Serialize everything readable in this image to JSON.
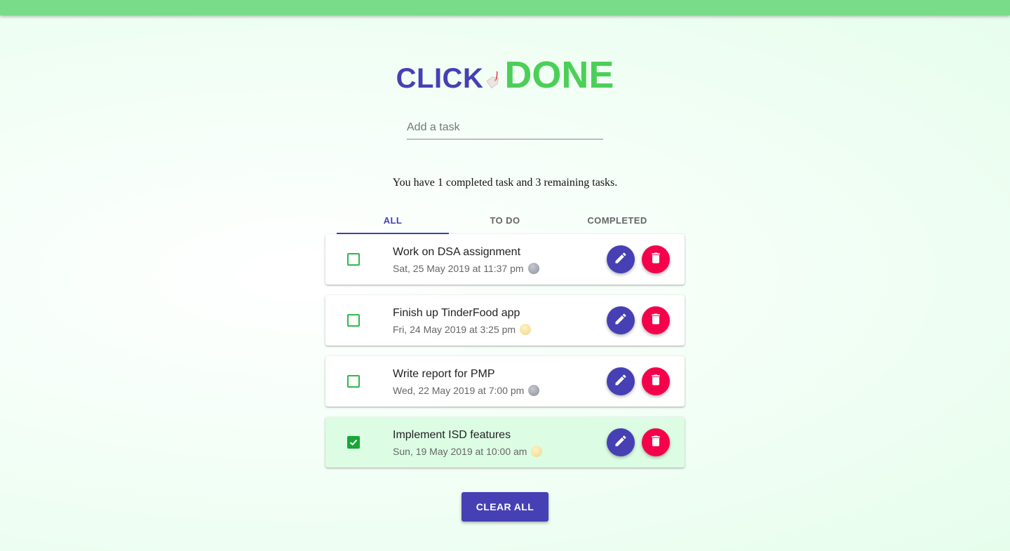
{
  "logo": {
    "part1": "CLICK",
    "part2": "DONE",
    "tag_icon": "price-tag-icon"
  },
  "add_task": {
    "placeholder": "Add a task",
    "value": ""
  },
  "summary": "You have 1 completed task and 3 remaining tasks.",
  "tabs": [
    {
      "label": "ALL",
      "active": true
    },
    {
      "label": "TO DO",
      "active": false
    },
    {
      "label": "COMPLETED",
      "active": false
    }
  ],
  "tasks": [
    {
      "title": "Work on DSA assignment",
      "time": "Sat, 25 May 2019 at 11:37 pm",
      "time_icon": "moon-icon",
      "completed": false
    },
    {
      "title": "Finish up TinderFood app",
      "time": "Fri, 24 May 2019 at 3:25 pm",
      "time_icon": "sun-icon",
      "completed": false
    },
    {
      "title": "Write report for PMP",
      "time": "Wed, 22 May 2019 at 7:00 pm",
      "time_icon": "moon-icon",
      "completed": false
    },
    {
      "title": "Implement ISD features",
      "time": "Sun, 19 May 2019 at 10:00 am",
      "time_icon": "sun-icon",
      "completed": true
    }
  ],
  "actions": {
    "edit_icon": "pencil-icon",
    "delete_icon": "trash-icon"
  },
  "clear_all_label": "CLEAR ALL",
  "colors": {
    "primary": "#4640b4",
    "accent_green": "#4ccf58",
    "delete_red": "#f5004b",
    "completed_bg": "#dcfde4",
    "topbar": "#78dc88"
  }
}
